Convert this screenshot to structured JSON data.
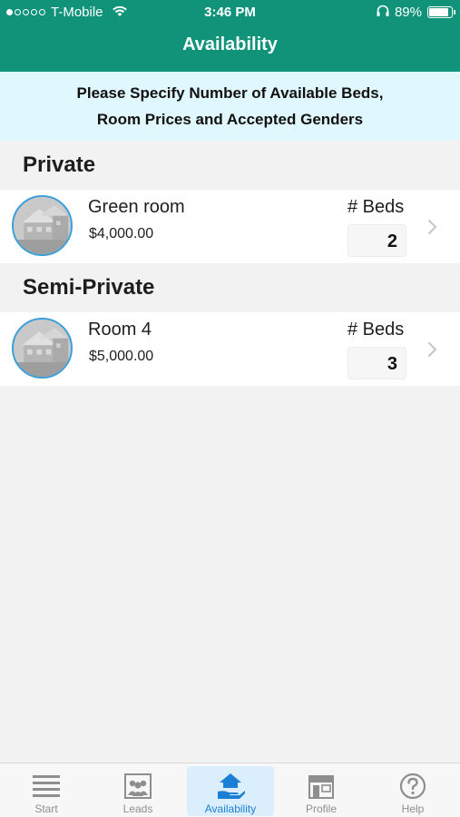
{
  "status": {
    "carrier": "T-Mobile",
    "time": "3:46 PM",
    "battery": "89%",
    "battery_level": 0.89
  },
  "nav": {
    "title": "Availability"
  },
  "banner": {
    "line1": "Please Specify Number of Available Beds,",
    "line2": "Room Prices and Accepted Genders"
  },
  "sections": [
    {
      "title": "Private",
      "rooms": [
        {
          "name": "Green room",
          "price": "$4,000.00",
          "beds_label": "# Beds",
          "beds": "2"
        }
      ]
    },
    {
      "title": "Semi-Private",
      "rooms": [
        {
          "name": "Room 4",
          "price": "$5,000.00",
          "beds_label": "# Beds",
          "beds": "3"
        }
      ]
    }
  ],
  "tabs": [
    {
      "label": "Start",
      "icon": "list-icon",
      "active": false
    },
    {
      "label": "Leads",
      "icon": "people-icon",
      "active": false
    },
    {
      "label": "Availability",
      "icon": "house-hand-icon",
      "active": true
    },
    {
      "label": "Profile",
      "icon": "storefront-icon",
      "active": false
    },
    {
      "label": "Help",
      "icon": "question-icon",
      "active": false
    }
  ],
  "colors": {
    "header": "#11937a",
    "banner": "#dff7fd",
    "active_tab": "#1c7fd6"
  }
}
